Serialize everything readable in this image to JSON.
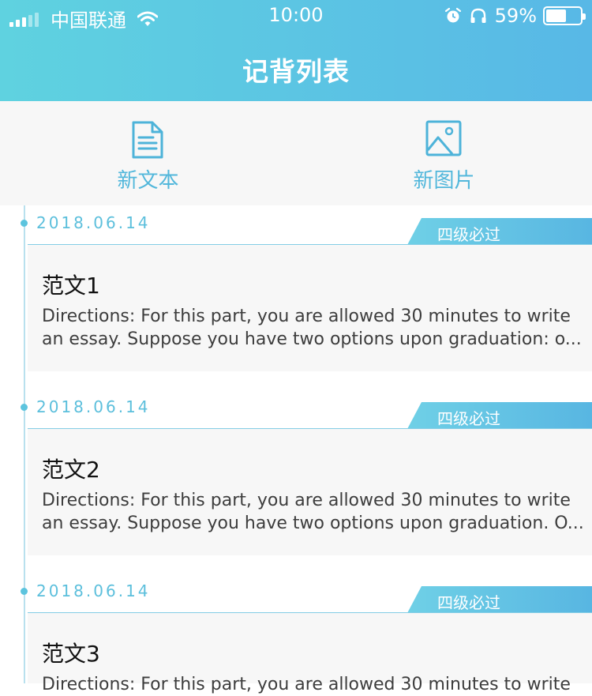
{
  "status_bar": {
    "carrier": "中国联通",
    "time": "10:00",
    "battery_percent": "59%",
    "battery_level": 0.59
  },
  "header": {
    "title": "记背列表"
  },
  "actions": [
    {
      "label": "新文本",
      "icon": "document-icon"
    },
    {
      "label": "新图片",
      "icon": "image-icon"
    }
  ],
  "entries": [
    {
      "date": "2018.06.14",
      "tag": "四级必过",
      "title": "范文1",
      "line1": "Directions: For this part, you are allowed 30 minutes to write",
      "line2": "an essay. Suppose you have two options upon graduation: o..."
    },
    {
      "date": "2018.06.14",
      "tag": "四级必过",
      "title": "范文2",
      "line1": "Directions: For this part, you are allowed 30 minutes to write",
      "line2": "an essay. Suppose you have two options upon graduation. O..."
    },
    {
      "date": "2018.06.14",
      "tag": "四级必过",
      "title": "范文3",
      "line1": "Directions: For this part, you are allowed 30 minutes to write",
      "line2": ""
    }
  ],
  "colors": {
    "accent": "#58b8e6",
    "accent_light": "#5fd2e0",
    "card_bg": "#f7f7f7"
  }
}
